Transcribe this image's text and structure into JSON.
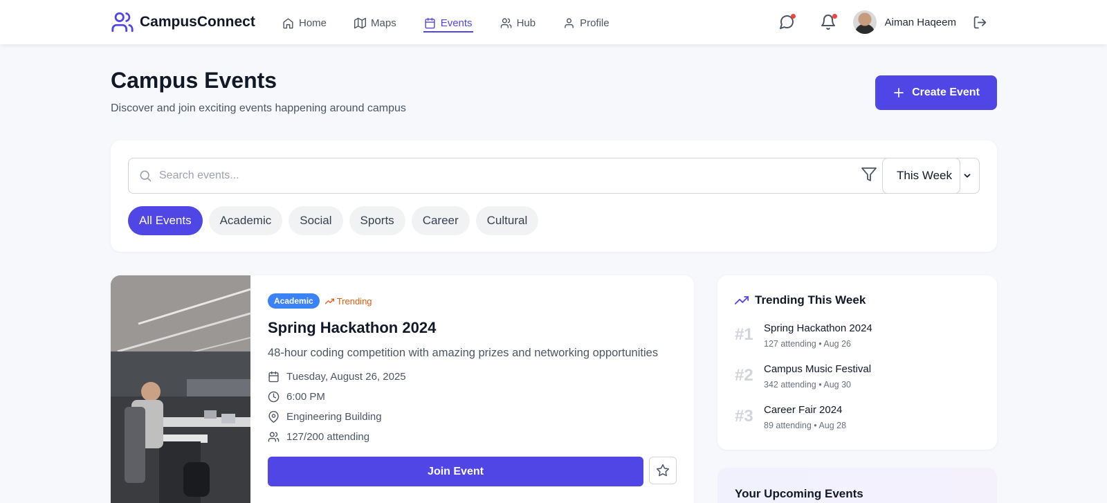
{
  "brand": {
    "name": "CampusConnect"
  },
  "nav": {
    "items": [
      {
        "label": "Home",
        "icon": "home-icon"
      },
      {
        "label": "Maps",
        "icon": "map-icon"
      },
      {
        "label": "Events",
        "icon": "calendar-icon",
        "active": true
      },
      {
        "label": "Hub",
        "icon": "users-icon"
      },
      {
        "label": "Profile",
        "icon": "user-icon"
      }
    ],
    "user_name": "Aiman Haqeem"
  },
  "header": {
    "title": "Campus Events",
    "subtitle": "Discover and join exciting events happening around campus",
    "create_label": "Create Event"
  },
  "filters": {
    "search_placeholder": "Search events...",
    "time_range": "This Week",
    "categories": [
      "All Events",
      "Academic",
      "Social",
      "Sports",
      "Career",
      "Cultural"
    ],
    "active_category": "All Events"
  },
  "event": {
    "category": "Academic",
    "trending_label": "Trending",
    "title": "Spring Hackathon 2024",
    "description": "48-hour coding competition with amazing prizes and networking opportunities",
    "date": "Tuesday, August 26, 2025",
    "time": "6:00 PM",
    "location": "Engineering Building",
    "attendance": "127/200 attending",
    "join_label": "Join Event"
  },
  "trending": {
    "title": "Trending This Week",
    "items": [
      {
        "rank": "#1",
        "name": "Spring Hackathon 2024",
        "meta": "127 attending • Aug 26"
      },
      {
        "rank": "#2",
        "name": "Campus Music Festival",
        "meta": "342 attending • Aug 30"
      },
      {
        "rank": "#3",
        "name": "Career Fair 2024",
        "meta": "89 attending • Aug 28"
      }
    ]
  },
  "upcoming": {
    "title": "Your Upcoming Events"
  },
  "colors": {
    "accent": "#4f46e5",
    "tag_blue": "#3b82f6",
    "trending_orange": "#ea580c",
    "notification_dot": "#ef4444"
  }
}
